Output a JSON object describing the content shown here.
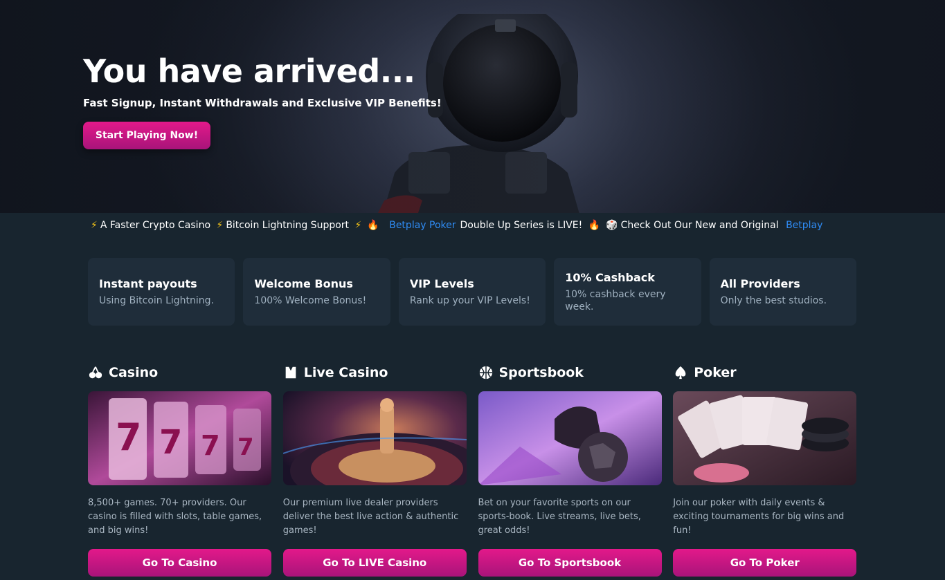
{
  "hero": {
    "title": "You have arrived...",
    "subtitle": "Fast Signup, Instant Withdrawals and Exclusive VIP Benefits!",
    "cta_label": "Start Playing Now!"
  },
  "ticker": {
    "items": [
      {
        "icon": "lightning-icon",
        "glyph": "⚡"
      },
      {
        "text": "A Faster Crypto Casino"
      },
      {
        "icon": "lightning-icon",
        "glyph": "⚡"
      },
      {
        "text": "Bitcoin Lightning Support"
      },
      {
        "icon": "lightning-icon",
        "glyph": "⚡"
      },
      {
        "icon": "fire-icon",
        "glyph": "🔥"
      },
      {
        "link": "Betplay Poker"
      },
      {
        "text": "Double Up Series is LIVE!"
      },
      {
        "icon": "fire-icon",
        "glyph": "🔥"
      },
      {
        "icon": "dice-icon",
        "glyph": "🎲"
      },
      {
        "text": "Check Out Our New and Original"
      },
      {
        "link": "Betplay"
      }
    ]
  },
  "features": [
    {
      "title": "Instant payouts",
      "desc": "Using Bitcoin Lightning."
    },
    {
      "title": "Welcome Bonus",
      "desc": "100% Welcome Bonus!"
    },
    {
      "title": "VIP Levels",
      "desc": "Rank up your VIP Levels!"
    },
    {
      "title": "10% Cashback",
      "desc": "10% cashback every week."
    },
    {
      "title": "All Providers",
      "desc": "Only the best studios."
    }
  ],
  "categories": [
    {
      "title": "Casino",
      "icon": "cherries-icon",
      "desc": "8,500+ games. 70+ providers. Our casino is filled with slots, table games, and big wins!",
      "button": "Go To Casino"
    },
    {
      "title": "Live Casino",
      "icon": "dealer-vest-icon",
      "desc": "Our premium live dealer providers deliver the best live action & authentic games!",
      "button": "Go To LIVE Casino"
    },
    {
      "title": "Sportsbook",
      "icon": "basketball-icon",
      "desc": "Bet on your favorite sports on our sports-book. Live streams, live bets, great odds!",
      "button": "Go To Sportsbook"
    },
    {
      "title": "Poker",
      "icon": "spade-icon",
      "desc": "Join our poker with daily events & exciting tournaments for big wins and fun!",
      "button": "Go To Poker"
    }
  ],
  "colors": {
    "background": "#18252f",
    "card": "#1f2d3a",
    "accent_pink": "#e3198a",
    "link_blue": "#2f8cf5"
  }
}
